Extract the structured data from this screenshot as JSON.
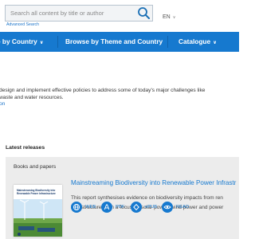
{
  "header": {
    "search": {
      "placeholder": "Search all content by title or author"
    },
    "advanced_search": "Advanced Search",
    "language": "EN"
  },
  "nav": {
    "items": [
      {
        "label": "e by Country"
      },
      {
        "label": "Browse by Theme and Country"
      },
      {
        "label": "Catalogue"
      }
    ]
  },
  "intro": {
    "line1": "design and implement effective policies to address some of today's major challenges like",
    "line2": "waste and water resources.",
    "link": "on"
  },
  "latest": {
    "title": "Latest releases",
    "panel_title": "Books and papers",
    "item": {
      "title": "Mainstreaming Biodiversity into Renewable Power Infrastr",
      "desc_line1": "This report synthesises evidence on biodiversity impacts from ren",
      "desc_line2": "infrastructure, with a focus on solar power, wind power and power",
      "cover_title": "Mainstreaming Biodiversity into Renewable Power Infrastructure",
      "actions": [
        {
          "label": "WEB",
          "icon": "globe-icon"
        },
        {
          "label": "PDF",
          "icon": "pdf-icon"
        },
        {
          "label": "ePUB",
          "icon": "epub-icon"
        },
        {
          "label": "READ",
          "icon": "eye-icon"
        }
      ]
    }
  },
  "colors": {
    "brand_blue": "#1679cf",
    "nav_text": "#ffffff",
    "panel_bg": "#ececec",
    "link": "#1a73c9"
  }
}
